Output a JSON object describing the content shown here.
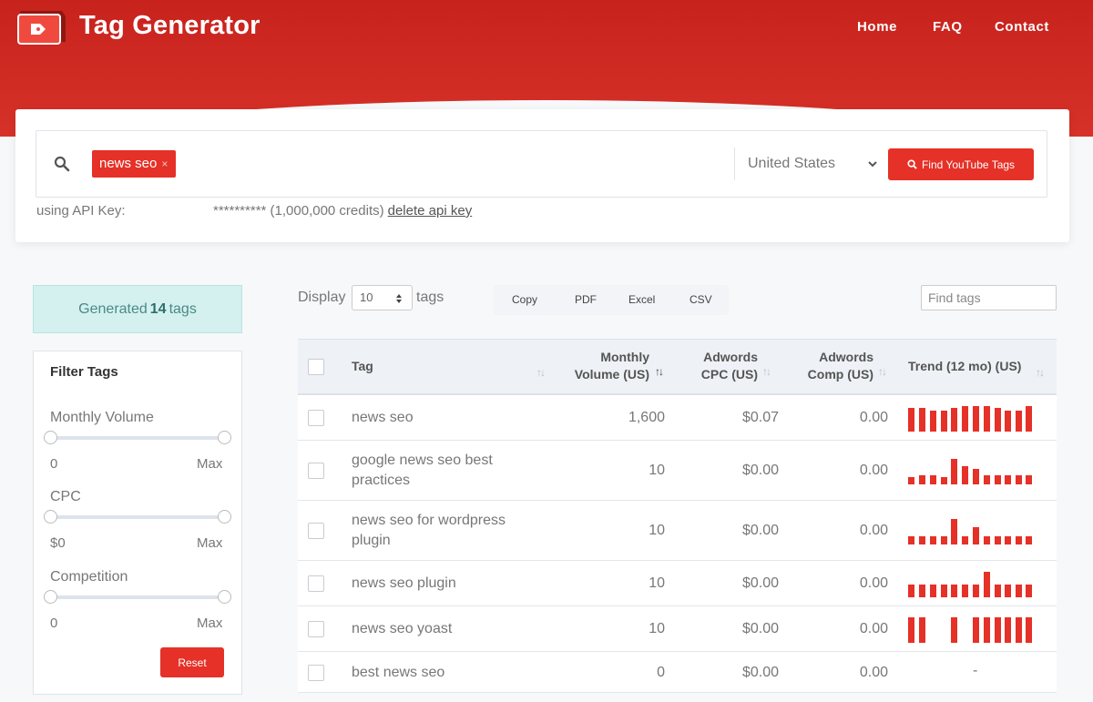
{
  "header": {
    "brand": "Tag Generator",
    "nav": [
      "Home",
      "FAQ",
      "Contact"
    ]
  },
  "search": {
    "chip": "news seo",
    "chip_remove": "×",
    "country": "United States",
    "find_button": "Find YouTube Tags",
    "api_label": "using API Key:",
    "api_value": "********** (1,000,000 credits)",
    "api_delete": "delete api key"
  },
  "sidebar": {
    "generated_prefix": "Generated",
    "generated_count": "14",
    "generated_suffix": "tags",
    "filter_title": "Filter Tags",
    "filters": [
      {
        "label": "Monthly Volume",
        "min": "0",
        "max": "Max"
      },
      {
        "label": "CPC",
        "min": "$0",
        "max": "Max"
      },
      {
        "label": "Competition",
        "min": "0",
        "max": "Max"
      }
    ],
    "reset": "Reset"
  },
  "toolbar": {
    "display": "Display",
    "page_size": "10",
    "tags": "tags",
    "exports": [
      "Copy",
      "PDF",
      "Excel",
      "CSV"
    ],
    "find_placeholder": "Find tags"
  },
  "table": {
    "headers": {
      "tag": "Tag",
      "volume_1": "Monthly",
      "volume_2": "Volume (US)",
      "cpc_1": "Adwords",
      "cpc_2": "CPC (US)",
      "comp_1": "Adwords",
      "comp_2": "Comp (US)",
      "trend": "Trend (12 mo) (US)"
    },
    "rows": [
      {
        "tag": "news seo",
        "volume": "1,600",
        "cpc": "$0.07",
        "comp": "0.00",
        "trend": [
          0.86,
          0.86,
          0.78,
          0.78,
          0.86,
          0.93,
          0.93,
          0.93,
          0.86,
          0.78,
          0.78,
          0.93
        ]
      },
      {
        "tag": "google news seo best practices",
        "volume": "10",
        "cpc": "$0.00",
        "comp": "0.00",
        "trend": [
          0.25,
          0.33,
          0.33,
          0.25,
          0.93,
          0.67,
          0.58,
          0.33,
          0.33,
          0.33,
          0.33,
          0.33
        ]
      },
      {
        "tag": "news seo for wordpress plugin",
        "volume": "10",
        "cpc": "$0.00",
        "comp": "0.00",
        "trend": [
          0.3,
          0.3,
          0.3,
          0.3,
          0.93,
          0.3,
          0.63,
          0.3,
          0.3,
          0.3,
          0.3,
          0.3
        ]
      },
      {
        "tag": "news seo plugin",
        "volume": "10",
        "cpc": "$0.00",
        "comp": "0.00",
        "trend": [
          0.45,
          0.45,
          0.45,
          0.45,
          0.45,
          0.45,
          0.45,
          0.93,
          0.45,
          0.45,
          0.45,
          0.45
        ]
      },
      {
        "tag": "news seo yoast",
        "volume": "10",
        "cpc": "$0.00",
        "comp": "0.00",
        "trend": [
          0.93,
          0.93,
          0,
          0,
          0.93,
          0,
          0.93,
          0.93,
          0.93,
          0.93,
          0.93,
          0.93
        ]
      },
      {
        "tag": "best news seo",
        "volume": "0",
        "cpc": "$0.00",
        "comp": "0.00",
        "trend": [],
        "trend_text": "-"
      }
    ]
  },
  "colors": {
    "brand_red": "#e53127",
    "header_red": "#c8221d",
    "teal_bg": "#d4f1ef"
  }
}
